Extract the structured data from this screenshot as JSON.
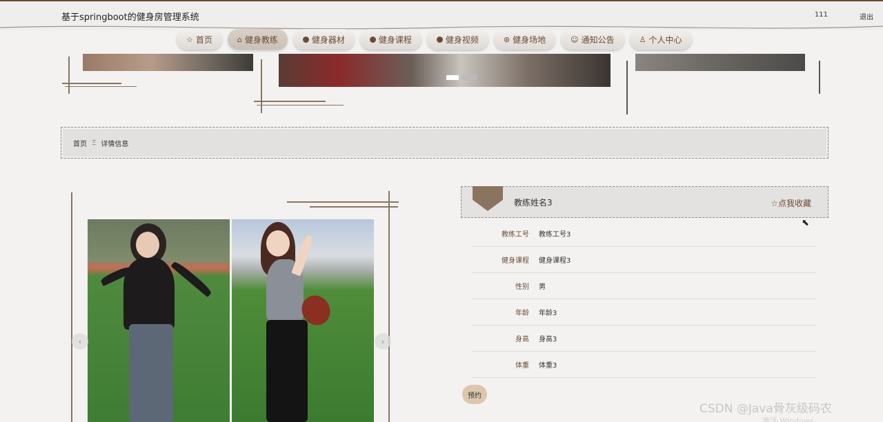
{
  "app": {
    "title": "基于springboot的健身房管理系统"
  },
  "topbar": {
    "user": "111",
    "logout": "退出"
  },
  "nav": [
    {
      "label": "首页",
      "icon": "star-icon"
    },
    {
      "label": "健身教练",
      "icon": "bag-icon",
      "active": true
    },
    {
      "label": "健身器材",
      "icon": "info-icon"
    },
    {
      "label": "健身课程",
      "icon": "info-icon"
    },
    {
      "label": "健身视频",
      "icon": "info-icon"
    },
    {
      "label": "健身场地",
      "icon": "compass-icon"
    },
    {
      "label": "通知公告",
      "icon": "smile-icon"
    },
    {
      "label": "个人中心",
      "icon": "user-icon"
    }
  ],
  "breadcrumb": {
    "home": "首页",
    "separator": "Ξ",
    "current": "详情信息"
  },
  "detail": {
    "name": "教练姓名3",
    "favorite": "☆点我收藏",
    "fields": [
      {
        "label": "教练工号",
        "value": "教练工号3"
      },
      {
        "label": "健身课程",
        "value": "健身课程3"
      },
      {
        "label": "性别",
        "value": "男"
      },
      {
        "label": "年龄",
        "value": "年龄3"
      },
      {
        "label": "身高",
        "value": "身高3"
      },
      {
        "label": "体重",
        "value": "体重3"
      }
    ],
    "book_label": "预约"
  },
  "watermark": {
    "csdn": "CSDN @Java骨灰级码农",
    "windows": "激活 Windows"
  },
  "colors": {
    "accent": "#6a4b35",
    "brown": "#8a7460",
    "button": "#dcc7ae"
  }
}
